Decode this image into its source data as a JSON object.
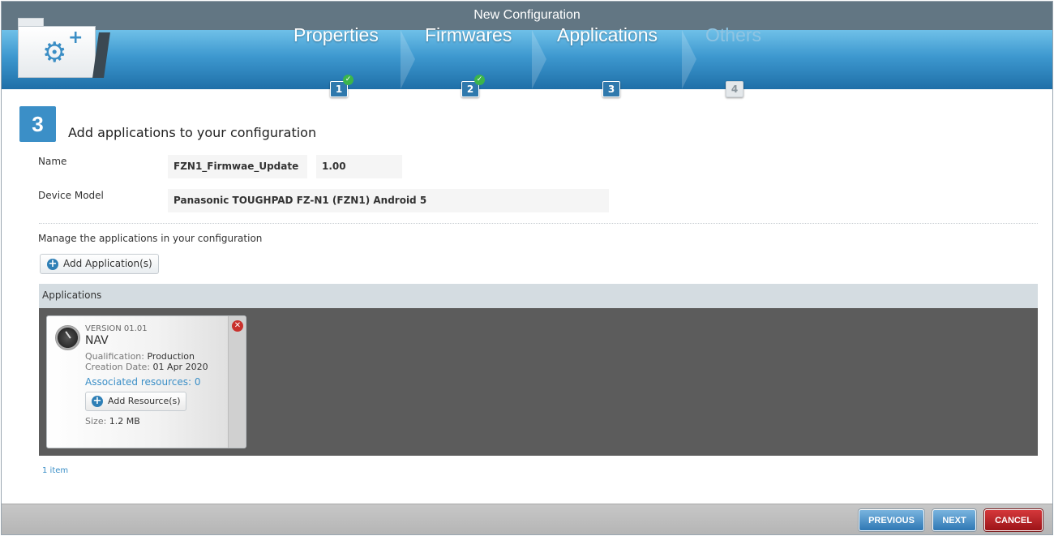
{
  "window": {
    "title": "New Configuration"
  },
  "wizard": {
    "steps": [
      {
        "label": "Properties",
        "number": "1",
        "status": "completed"
      },
      {
        "label": "Firmwares",
        "number": "2",
        "status": "completed"
      },
      {
        "label": "Applications",
        "number": "3",
        "status": "current"
      },
      {
        "label": "Others",
        "number": "4",
        "status": "disabled"
      }
    ]
  },
  "section": {
    "number": "3",
    "heading": "Add applications to your configuration"
  },
  "form": {
    "name_label": "Name",
    "name_value": "FZN1_Firmwae_Update",
    "version_value": "1.00",
    "device_label": "Device Model",
    "device_value": "Panasonic TOUGHPAD FZ-N1 (FZN1) Android 5"
  },
  "apps": {
    "manage_text": "Manage the applications in your configuration",
    "add_button": "Add Application(s)",
    "header": "Applications",
    "items": [
      {
        "version": "VERSION 01.01",
        "name": "NAV",
        "qualification_label": "Qualification:",
        "qualification": "Production",
        "creation_label": "Creation Date:",
        "creation_date": "01 Apr 2020",
        "associated": "Associated resources: 0",
        "add_resource": "Add Resource(s)",
        "size_label": "Size:",
        "size": "1.2 MB"
      }
    ],
    "count": "1 item"
  },
  "footer": {
    "previous": "PREVIOUS",
    "next": "NEXT",
    "cancel": "CANCEL"
  },
  "colors": {
    "accent": "#3b8fc7",
    "cancel": "#b71c1f",
    "header": "#627683",
    "success": "#3bb54a"
  },
  "icons": {
    "folder": "folder-gear-plus-icon",
    "check": "check-circle-icon",
    "add": "plus-circle-icon",
    "remove": "remove-x-icon",
    "app": "compass-icon"
  }
}
